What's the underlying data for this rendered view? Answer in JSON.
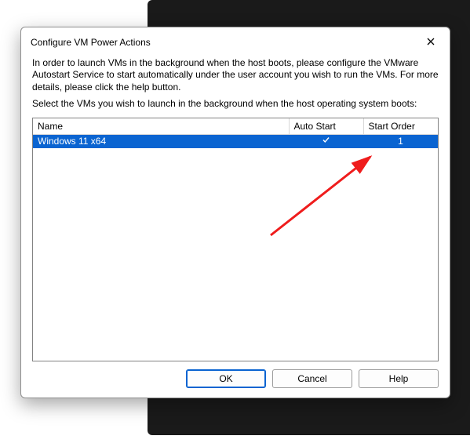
{
  "dialog": {
    "title": "Configure VM Power Actions",
    "instructions1": "In order to launch VMs in the background when the host boots, please configure the VMware Autostart Service to start automatically under the user account you wish to run the VMs. For more details, please click the help button.",
    "instructions2": "Select the VMs you wish to launch in the background when the host operating system boots:"
  },
  "columns": {
    "name": "Name",
    "autostart": "Auto Start",
    "order": "Start Order"
  },
  "rows": [
    {
      "name": "Windows 11 x64",
      "autostart": true,
      "order": "1",
      "selected": true
    }
  ],
  "buttons": {
    "ok": "OK",
    "cancel": "Cancel",
    "help": "Help"
  }
}
